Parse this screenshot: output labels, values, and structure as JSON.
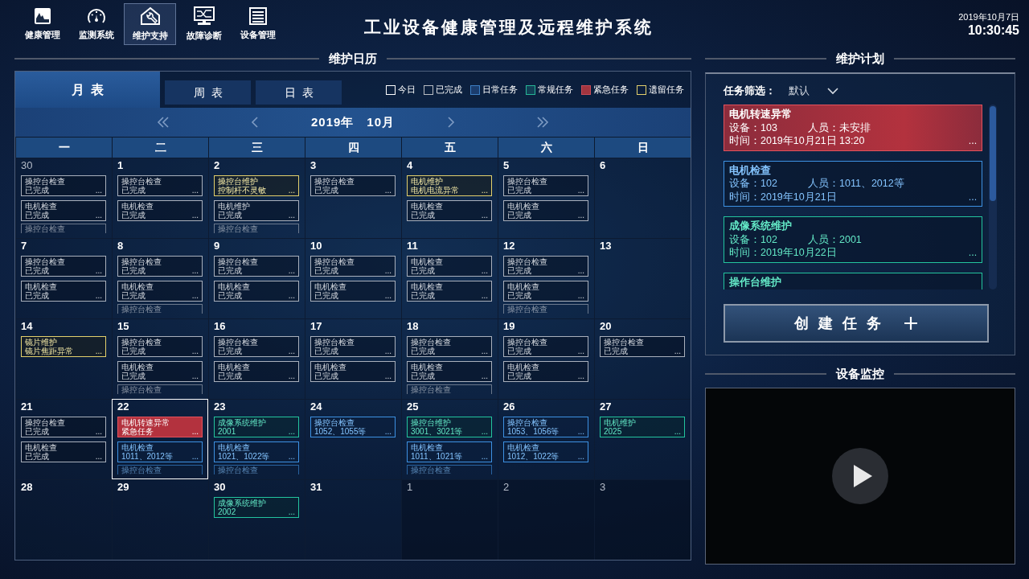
{
  "header": {
    "nav": [
      {
        "label": "健康管理",
        "selected": false
      },
      {
        "label": "监测系统",
        "selected": false
      },
      {
        "label": "维护支持",
        "selected": true
      },
      {
        "label": "故障诊断",
        "selected": false
      },
      {
        "label": "设备管理",
        "selected": false
      }
    ],
    "title": "工业设备健康管理及远程维护系统",
    "date": "2019年10月7日",
    "time": "10:30:45"
  },
  "calendar": {
    "title": "维护日历",
    "tabs": [
      {
        "label": "月表",
        "selected": true
      },
      {
        "label": "周表",
        "selected": false
      },
      {
        "label": "日表",
        "selected": false
      }
    ],
    "legend": [
      {
        "kind": "today",
        "label": "今日"
      },
      {
        "kind": "done",
        "label": "已完成"
      },
      {
        "kind": "routine",
        "label": "日常任务"
      },
      {
        "kind": "regular",
        "label": "常规任务"
      },
      {
        "kind": "urgent",
        "label": "紧急任务"
      },
      {
        "kind": "leftover",
        "label": "遗留任务"
      }
    ],
    "month_label": "2019年　10月",
    "weekdays": [
      "一",
      "二",
      "三",
      "四",
      "五",
      "六",
      "日"
    ],
    "weeks": [
      {
        "days": [
          {
            "day": "30",
            "muted": true,
            "selected": false,
            "tasks": [
              {
                "kind": "done",
                "title": "操控台检查",
                "detail": "已完成",
                "more": "..."
              },
              {
                "kind": "done",
                "title": "电机检查",
                "detail": "已完成",
                "more": "..."
              }
            ],
            "overflow": {
              "kind": "done",
              "title": "操控台检查"
            }
          },
          {
            "day": "1",
            "muted": false,
            "selected": false,
            "tasks": [
              {
                "kind": "done",
                "title": "操控台检查",
                "detail": "已完成",
                "more": "..."
              },
              {
                "kind": "done",
                "title": "电机检查",
                "detail": "已完成",
                "more": "..."
              }
            ]
          },
          {
            "day": "2",
            "muted": false,
            "selected": false,
            "tasks": [
              {
                "kind": "leftover",
                "title": "操控台维护",
                "detail": "控制杆不灵敏",
                "more": "..."
              },
              {
                "kind": "done",
                "title": "电机维护",
                "detail": "已完成",
                "more": "..."
              }
            ],
            "overflow": {
              "kind": "done",
              "title": "操控台检查"
            }
          },
          {
            "day": "3",
            "muted": false,
            "selected": false,
            "tasks": [
              {
                "kind": "done",
                "title": "操控台检查",
                "detail": "已完成",
                "more": "..."
              }
            ]
          },
          {
            "day": "4",
            "muted": false,
            "selected": false,
            "tasks": [
              {
                "kind": "leftover",
                "title": "电机维护",
                "detail": "电机电流异常",
                "more": "..."
              },
              {
                "kind": "done",
                "title": "电机检查",
                "detail": "已完成",
                "more": "..."
              }
            ]
          },
          {
            "day": "5",
            "muted": false,
            "selected": false,
            "tasks": [
              {
                "kind": "done",
                "title": "操控台检查",
                "detail": "已完成",
                "more": "..."
              },
              {
                "kind": "done",
                "title": "电机检查",
                "detail": "已完成",
                "more": "..."
              }
            ]
          },
          {
            "day": "6",
            "muted": false,
            "selected": false
          }
        ]
      },
      {
        "days": [
          {
            "day": "7",
            "muted": false,
            "selected": false,
            "tasks": [
              {
                "kind": "done",
                "title": "操控台检查",
                "detail": "已完成",
                "more": "..."
              },
              {
                "kind": "done",
                "title": "电机检查",
                "detail": "已完成",
                "more": "..."
              }
            ]
          },
          {
            "day": "8",
            "muted": false,
            "selected": false,
            "tasks": [
              {
                "kind": "done",
                "title": "操控台检查",
                "detail": "已完成",
                "more": "..."
              },
              {
                "kind": "done",
                "title": "电机检查",
                "detail": "已完成",
                "more": "..."
              }
            ],
            "overflow": {
              "kind": "done",
              "title": "操控台检查"
            }
          },
          {
            "day": "9",
            "muted": false,
            "selected": false,
            "tasks": [
              {
                "kind": "done",
                "title": "操控台检查",
                "detail": "已完成",
                "more": "..."
              },
              {
                "kind": "done",
                "title": "电机检查",
                "detail": "已完成",
                "more": "..."
              }
            ]
          },
          {
            "day": "10",
            "muted": false,
            "selected": false,
            "tasks": [
              {
                "kind": "done",
                "title": "操控台检查",
                "detail": "已完成",
                "more": "..."
              },
              {
                "kind": "done",
                "title": "电机检查",
                "detail": "已完成",
                "more": "..."
              }
            ]
          },
          {
            "day": "11",
            "muted": false,
            "selected": false,
            "tasks": [
              {
                "kind": "done",
                "title": "电机检查",
                "detail": "已完成",
                "more": "..."
              },
              {
                "kind": "done",
                "title": "电机检查",
                "detail": "已完成",
                "more": "..."
              }
            ]
          },
          {
            "day": "12",
            "muted": false,
            "selected": false,
            "tasks": [
              {
                "kind": "done",
                "title": "操控台检查",
                "detail": "已完成",
                "more": "..."
              },
              {
                "kind": "done",
                "title": "电机检查",
                "detail": "已完成",
                "more": "..."
              }
            ],
            "overflow": {
              "kind": "done",
              "title": "操控台检查"
            }
          },
          {
            "day": "13",
            "muted": false,
            "selected": false
          }
        ]
      },
      {
        "days": [
          {
            "day": "14",
            "muted": false,
            "selected": false,
            "tasks": [
              {
                "kind": "leftover",
                "title": "镜片维护",
                "detail": "镜片焦距异常",
                "more": "..."
              }
            ]
          },
          {
            "day": "15",
            "muted": false,
            "selected": false,
            "tasks": [
              {
                "kind": "done",
                "title": "操控台检查",
                "detail": "已完成",
                "more": "..."
              },
              {
                "kind": "done",
                "title": "电机检查",
                "detail": "已完成",
                "more": "..."
              }
            ],
            "overflow": {
              "kind": "done",
              "title": "操控台检查"
            }
          },
          {
            "day": "16",
            "muted": false,
            "selected": false,
            "tasks": [
              {
                "kind": "done",
                "title": "操控台检查",
                "detail": "已完成",
                "more": "..."
              },
              {
                "kind": "done",
                "title": "电机检查",
                "detail": "已完成",
                "more": "..."
              }
            ]
          },
          {
            "day": "17",
            "muted": false,
            "selected": false,
            "tasks": [
              {
                "kind": "done",
                "title": "操控台检查",
                "detail": "已完成",
                "more": "..."
              },
              {
                "kind": "done",
                "title": "电机检查",
                "detail": "已完成",
                "more": "..."
              }
            ]
          },
          {
            "day": "18",
            "muted": false,
            "selected": false,
            "tasks": [
              {
                "kind": "done",
                "title": "操控台检查",
                "detail": "已完成",
                "more": "..."
              },
              {
                "kind": "done",
                "title": "电机检查",
                "detail": "已完成",
                "more": "..."
              }
            ],
            "overflow": {
              "kind": "done",
              "title": "操控台检查"
            }
          },
          {
            "day": "19",
            "muted": false,
            "selected": false,
            "tasks": [
              {
                "kind": "done",
                "title": "操控台检查",
                "detail": "已完成",
                "more": "..."
              },
              {
                "kind": "done",
                "title": "电机检查",
                "detail": "已完成",
                "more": "..."
              }
            ]
          },
          {
            "day": "20",
            "muted": false,
            "selected": false,
            "tasks": [
              {
                "kind": "done",
                "title": "操控台检查",
                "detail": "已完成",
                "more": "..."
              }
            ]
          }
        ]
      },
      {
        "days": [
          {
            "day": "21",
            "muted": false,
            "selected": false,
            "tasks": [
              {
                "kind": "done",
                "title": "操控台检查",
                "detail": "已完成",
                "more": "..."
              },
              {
                "kind": "done",
                "title": "电机检查",
                "detail": "已完成",
                "more": "..."
              }
            ]
          },
          {
            "day": "22",
            "muted": false,
            "selected": true,
            "tasks": [
              {
                "kind": "urgent",
                "title": "电机转速异常",
                "detail": "紧急任务",
                "more": "..."
              },
              {
                "kind": "routine",
                "title": "电机检查",
                "detail": "1011、2012等",
                "more": "..."
              }
            ],
            "overflow": {
              "kind": "routine",
              "title": "操控台检查"
            }
          },
          {
            "day": "23",
            "muted": false,
            "selected": false,
            "tasks": [
              {
                "kind": "regular",
                "title": "成像系统维护",
                "detail": "2001",
                "more": "..."
              },
              {
                "kind": "routine",
                "title": "电机检查",
                "detail": "1021、1022等",
                "more": "..."
              }
            ],
            "overflow": {
              "kind": "routine",
              "title": "操控台检查"
            }
          },
          {
            "day": "24",
            "muted": false,
            "selected": false,
            "tasks": [
              {
                "kind": "routine",
                "title": "操控台检查",
                "detail": "1052、1055等",
                "more": "..."
              }
            ]
          },
          {
            "day": "25",
            "muted": false,
            "selected": false,
            "tasks": [
              {
                "kind": "regular",
                "title": "操控台维护",
                "detail": "3001、3021等",
                "more": "..."
              },
              {
                "kind": "routine",
                "title": "电机检查",
                "detail": "1011、1021等",
                "more": "..."
              }
            ],
            "overflow": {
              "kind": "routine",
              "title": "操控台检查"
            }
          },
          {
            "day": "26",
            "muted": false,
            "selected": false,
            "tasks": [
              {
                "kind": "routine",
                "title": "操控台检查",
                "detail": "1053、1056等",
                "more": "..."
              },
              {
                "kind": "routine",
                "title": "电机检查",
                "detail": "1012、1022等",
                "more": "..."
              }
            ]
          },
          {
            "day": "27",
            "muted": false,
            "selected": false,
            "tasks": [
              {
                "kind": "regular",
                "title": "电机维护",
                "detail": "2025",
                "more": "..."
              }
            ]
          }
        ]
      },
      {
        "days": [
          {
            "day": "28",
            "muted": false,
            "selected": false
          },
          {
            "day": "29",
            "muted": false,
            "selected": false
          },
          {
            "day": "30",
            "muted": false,
            "selected": false,
            "tasks": [
              {
                "kind": "regular",
                "title": "成像系统维护",
                "detail": "2002",
                "more": "..."
              }
            ]
          },
          {
            "day": "31",
            "muted": false,
            "selected": false
          },
          {
            "day": "1",
            "muted": true,
            "selected": false
          },
          {
            "day": "2",
            "muted": true,
            "selected": false
          },
          {
            "day": "3",
            "muted": true,
            "selected": false
          }
        ]
      }
    ]
  },
  "plan": {
    "title": "维护计划",
    "filter_label": "任务筛选：",
    "filter_value": "默认",
    "tasks": [
      {
        "kind": "urgent",
        "title": "电机转速异常",
        "device": "设备：103",
        "person": "人员：未安排",
        "time": "时间：2019年10月21日 13:20",
        "more": "..."
      },
      {
        "kind": "routine",
        "title": "电机检查",
        "device": "设备：102",
        "person": "人员：1011、2012等",
        "time": "时间：2019年10月21日",
        "more": "..."
      },
      {
        "kind": "regular",
        "title": "成像系统维护",
        "device": "设备：102",
        "person": "人员：2001",
        "time": "时间：2019年10月22日",
        "more": "..."
      },
      {
        "kind": "regular",
        "title": "操作台维护"
      }
    ],
    "create_button": "创建任务"
  },
  "monitor": {
    "title": "设备监控"
  }
}
